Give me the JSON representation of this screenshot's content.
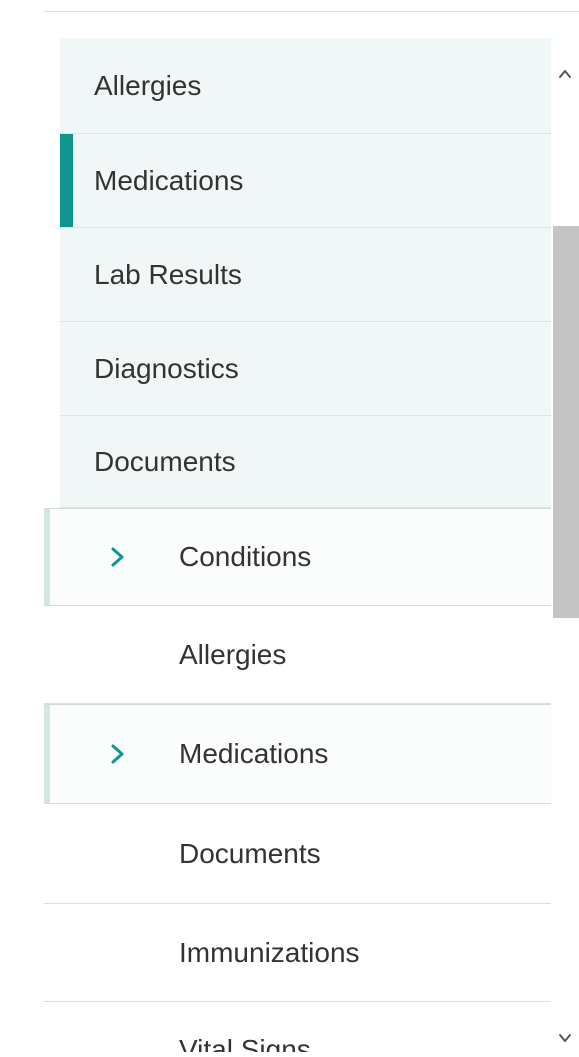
{
  "nav": {
    "top_items": [
      {
        "label": "Allergies"
      },
      {
        "label": "Medications",
        "active": true
      },
      {
        "label": "Lab Results"
      },
      {
        "label": "Diagnostics"
      },
      {
        "label": "Documents"
      }
    ],
    "sub_items": [
      {
        "label": "Conditions",
        "expandable": true
      },
      {
        "label": "Allergies"
      },
      {
        "label": "Medications",
        "expandable": true
      },
      {
        "label": "Documents"
      },
      {
        "label": "Immunizations"
      },
      {
        "label": "Vital Signs"
      }
    ]
  },
  "icons": {
    "expand": "chevron-right-icon",
    "scroll_up": "chevron-up-icon",
    "scroll_down": "chevron-down-icon"
  },
  "colors": {
    "accent": "#10958e",
    "top_item_bg": "#f1f7f7",
    "scroll_thumb": "#c4c4c4"
  }
}
